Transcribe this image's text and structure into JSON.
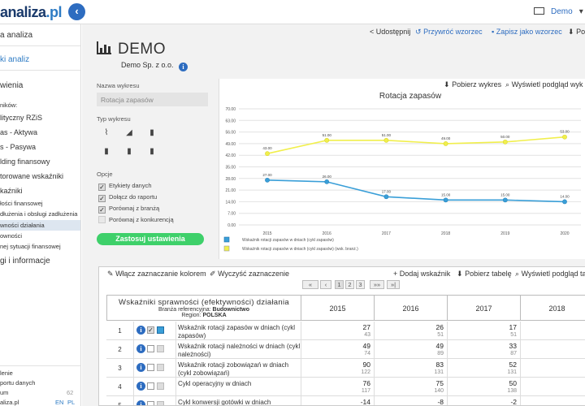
{
  "header": {
    "logo_main": "analiza",
    "logo_suffix": ".pl",
    "collapse_icon": "chevron-left-icon",
    "user_label": "Demo",
    "user_chevron": "▾"
  },
  "sidebar": {
    "items": [
      "a analiza",
      "ki analiz",
      "wienia",
      "ników:",
      "lityczny RZiS",
      "as - Aktywa",
      "s - Pasywa",
      "lding finansowy",
      "torowane wskaźniki",
      "kaźniki",
      "łości finansowej",
      "dłużenia i obsługi zadłużenia",
      "wności działania",
      "owności",
      "nej sytuacji finansowej",
      "gi i informacje"
    ],
    "footer": [
      "lenie",
      "portu danych",
      "um",
      "aliza.pl"
    ],
    "footer_tag": "62",
    "lang_en": "EN",
    "lang_pl": "PL"
  },
  "toolbar": {
    "share": "Udostępnij",
    "restore": "Przywróć wzorzec",
    "save_template": "Zapisz jako wzorzec",
    "download": "Pob"
  },
  "company": {
    "title": "DEMO",
    "subtitle": "Demo Sp. z o.o."
  },
  "form": {
    "name_label": "Nazwa wykresu",
    "name_value": "Rotacja zapasów",
    "type_label": "Typ wykresu",
    "options_label": "Opcje",
    "options": [
      {
        "label": "Etykiety danych",
        "checked": true
      },
      {
        "label": "Dołącz do raportu",
        "checked": true
      },
      {
        "label": "Porównaj z branżą",
        "checked": true
      },
      {
        "label": "Porównaj z konkurencją",
        "checked": false
      }
    ],
    "apply": "Zastosuj ustawienia"
  },
  "chart_actions": {
    "download": "Pobierz wykres",
    "preview": "Wyświetl podgląd wyk"
  },
  "chart_data": {
    "type": "line",
    "title": "Rotacja zapasów",
    "x": [
      "2015",
      "2016",
      "2017",
      "2018",
      "2019",
      "2020"
    ],
    "yticks": [
      "70.00",
      "63.00",
      "56.00",
      "49.00",
      "42.00",
      "35.00",
      "28.00",
      "21.00",
      "14.00",
      "7.00",
      "0.00"
    ],
    "ylim": [
      0,
      70
    ],
    "series": [
      {
        "name": "Wskaźnik rotacji zapasów w dniach (cykl zapasów)",
        "color": "#3a9fd8",
        "values": [
          27,
          26,
          17,
          15,
          15,
          14
        ],
        "labels": [
          "27.00",
          "26.00",
          "17.00",
          "15.00",
          "15.00",
          "14.00"
        ]
      },
      {
        "name": "Wskaźnik rotacji zapasów w dniach (cykl zapasów) (wsk. branż.)",
        "color": "#f1ef4c",
        "values": [
          43,
          51,
          51,
          49,
          50,
          53
        ],
        "labels": [
          "43.00",
          "51.00",
          "51.00",
          "49.00",
          "50.00",
          "53.00"
        ]
      }
    ]
  },
  "table_actions": {
    "color_select": "Włącz zaznaczanie kolorem",
    "clear": "Wyczyść zaznaczenie",
    "add": "Dodaj wskaźnik",
    "download": "Pobierz tabelę",
    "preview": "Wyświetl podgląd ta"
  },
  "pager": {
    "first": "«",
    "prev": "‹",
    "pages": [
      "1",
      "2",
      "3"
    ],
    "next": "»»",
    "last": "»|"
  },
  "table": {
    "title": "Wskaźniki sprawności (efektywności) działania",
    "industry_prefix": "Branża referencyjna:",
    "industry": "Budownictwo",
    "region_prefix": "Region:",
    "region": "POLSKA",
    "years": [
      "2015",
      "2016",
      "2017",
      "2018"
    ],
    "rows": [
      {
        "num": "1",
        "name": "Wskaźnik rotacji zapasów w dniach (cykl zapasów)",
        "vals": [
          [
            "27",
            "43"
          ],
          [
            "26",
            "51"
          ],
          [
            "17",
            "51"
          ],
          [
            "1",
            ""
          ]
        ]
      },
      {
        "num": "2",
        "name": "Wskaźnik rotacji należności w dniach (cykl należności)",
        "vals": [
          [
            "49",
            "74"
          ],
          [
            "49",
            "89"
          ],
          [
            "33",
            "87"
          ],
          [
            "3",
            ""
          ]
        ]
      },
      {
        "num": "3",
        "name": "Wskaźnik rotacji zobowiązań w dniach (cykl zobowiązań)",
        "vals": [
          [
            "90",
            "122"
          ],
          [
            "83",
            "131"
          ],
          [
            "52",
            "131"
          ],
          [
            "4",
            ""
          ]
        ]
      },
      {
        "num": "4",
        "name": "Cykl operacyjny w dniach",
        "vals": [
          [
            "76",
            "117"
          ],
          [
            "75",
            "140"
          ],
          [
            "50",
            "138"
          ],
          [
            "4",
            ""
          ]
        ]
      },
      {
        "num": "5",
        "name": "Cykl konwersji gotówki w dniach",
        "vals": [
          [
            "-14",
            ""
          ],
          [
            "-8",
            ""
          ],
          [
            "-2",
            ""
          ],
          [
            "",
            ""
          ]
        ]
      }
    ]
  }
}
